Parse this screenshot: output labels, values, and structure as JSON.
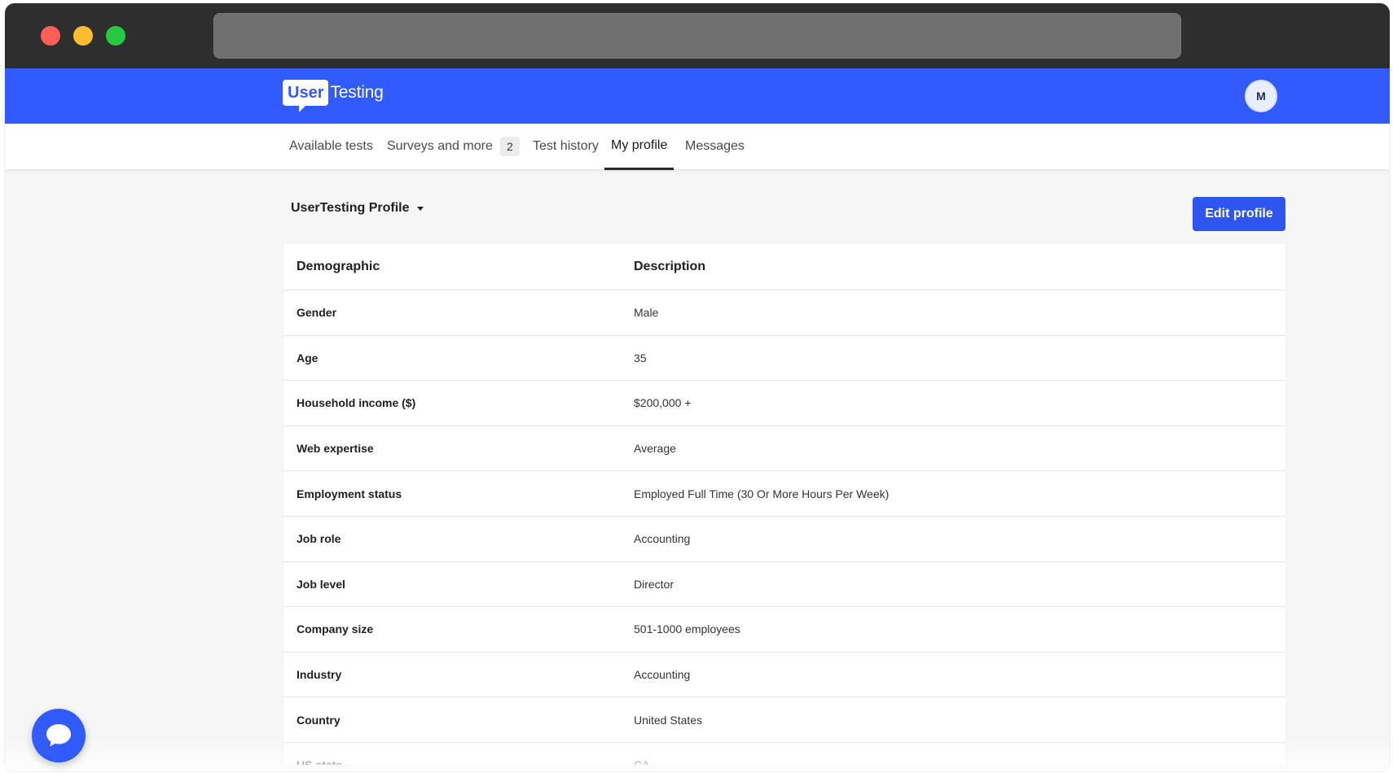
{
  "app": {
    "logo_box": "User",
    "logo_text": "Testing",
    "avatar_initial": "M"
  },
  "tabs": [
    {
      "label": "Available tests"
    },
    {
      "label": "Surveys and more",
      "badge": "2"
    },
    {
      "label": "Test history"
    },
    {
      "label": "My profile",
      "active": true
    },
    {
      "label": "Messages"
    }
  ],
  "profile": {
    "selector_label": "UserTesting Profile",
    "edit_button": "Edit profile"
  },
  "table": {
    "headers": [
      "Demographic",
      "Description"
    ],
    "rows": [
      [
        "Gender",
        "Male"
      ],
      [
        "Age",
        "35"
      ],
      [
        "Household income ($)",
        "$200,000 +"
      ],
      [
        "Web expertise",
        "Average"
      ],
      [
        "Employment status",
        "Employed Full Time (30 Or More Hours Per Week)"
      ],
      [
        "Job role",
        "Accounting"
      ],
      [
        "Job level",
        "Director"
      ],
      [
        "Company size",
        "501-1000 employees"
      ],
      [
        "Industry",
        "Accounting"
      ],
      [
        "Country",
        "United States"
      ],
      [
        "US state",
        "CA"
      ]
    ]
  },
  "colors": {
    "brand_blue": "#325bff",
    "button_blue": "#2e55f0"
  },
  "icons": {
    "chat": "chat-bubble-icon",
    "dropdown": "caret-down-icon"
  }
}
